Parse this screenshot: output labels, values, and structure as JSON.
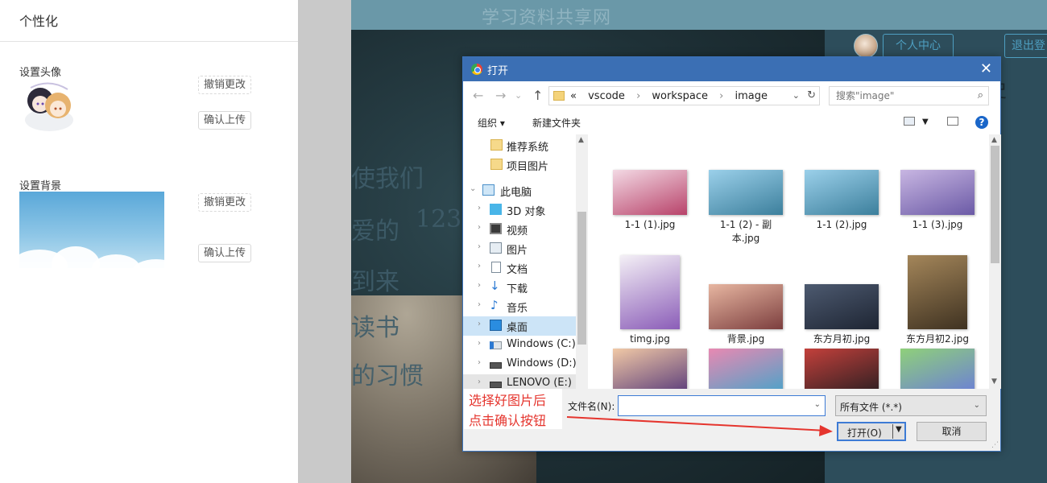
{
  "left_panel": {
    "title": "个性化",
    "avatar_section": {
      "label": "设置头像",
      "undo_label": "撤销更改",
      "confirm_label": "确认上传"
    },
    "background_section": {
      "label": "设置背景",
      "undo_label": "撤销更改",
      "confirm_label": "确认上传"
    }
  },
  "site": {
    "title": "学习资料共享网",
    "quote_lines": [
      "使我们",
      "爱的",
      "123",
      "到来",
      "读书",
      "的习惯"
    ],
    "personal_center": "个人中心",
    "logout": "退出登",
    "side_char": "史"
  },
  "dialog": {
    "title": "打开",
    "close_icon": "✕",
    "address": {
      "prefix": "«",
      "crumbs": [
        "vscode",
        "workspace",
        "image"
      ]
    },
    "search": {
      "placeholder": "搜索\"image\""
    },
    "toolbar": {
      "organize": "组织 ▾",
      "new_folder": "新建文件夹",
      "help": "?"
    },
    "nav_items": [
      {
        "label": "推荐系统",
        "icon": "folder-icon",
        "indent": 2
      },
      {
        "label": "项目图片",
        "icon": "folder-icon",
        "indent": 2
      },
      {
        "label": "此电脑",
        "icon": "computer-icon",
        "indent": 1,
        "expanded": true
      },
      {
        "label": "3D 对象",
        "icon": "cube-icon",
        "indent": 2
      },
      {
        "label": "视频",
        "icon": "video-icon",
        "indent": 2
      },
      {
        "label": "图片",
        "icon": "picture-icon",
        "indent": 2
      },
      {
        "label": "文档",
        "icon": "document-icon",
        "indent": 2
      },
      {
        "label": "下载",
        "icon": "download-icon",
        "indent": 2
      },
      {
        "label": "音乐",
        "icon": "music-icon",
        "indent": 2
      },
      {
        "label": "桌面",
        "icon": "desktop-icon",
        "indent": 2,
        "selected": true
      },
      {
        "label": "Windows (C:)",
        "icon": "drive-c-icon",
        "indent": 2
      },
      {
        "label": "Windows (D:)",
        "icon": "drive-icon",
        "indent": 2
      },
      {
        "label": "LENOVO (E:)",
        "icon": "drive-icon",
        "indent": 2
      }
    ],
    "files": [
      {
        "name": "1-1 (1).jpg",
        "colors": [
          "#f3d9e4",
          "#b8436a"
        ]
      },
      {
        "name": "1-1 (2) - 副本.jpg",
        "colors": [
          "#9bd0ea",
          "#3c7f9c"
        ]
      },
      {
        "name": "1-1 (2).jpg",
        "colors": [
          "#9bd0ea",
          "#3c7f9c"
        ]
      },
      {
        "name": "1-1 (3).jpg",
        "colors": [
          "#c8b6e2",
          "#6b5aa6"
        ]
      },
      {
        "name": "timg.jpg",
        "colors": [
          "#f4f0f6",
          "#8b5db8"
        ]
      },
      {
        "name": "背景.jpg",
        "colors": [
          "#e7b6a1",
          "#7c3e3e"
        ]
      },
      {
        "name": "东方月初.jpg",
        "colors": [
          "#4d5a70",
          "#1e2533"
        ]
      },
      {
        "name": "东方月初2.jpg",
        "colors": [
          "#a4865a",
          "#3f3221"
        ]
      },
      {
        "name": "",
        "colors": [
          "#f1c9a6",
          "#5a3c7a"
        ]
      },
      {
        "name": "",
        "colors": [
          "#e889b2",
          "#4aa3c9"
        ]
      },
      {
        "name": "",
        "colors": [
          "#c3403b",
          "#2c1f22"
        ]
      },
      {
        "name": "",
        "colors": [
          "#8fd07a",
          "#6c7fd6"
        ]
      }
    ],
    "filename_label": "文件名(N):",
    "filename_value": "",
    "filetype": "所有文件 (*.*)",
    "open_label": "打开(O)",
    "cancel_label": "取消"
  },
  "annotation": {
    "lines": [
      "选择好图片后",
      "点击确认按钮"
    ],
    "color": "#e5352e"
  }
}
